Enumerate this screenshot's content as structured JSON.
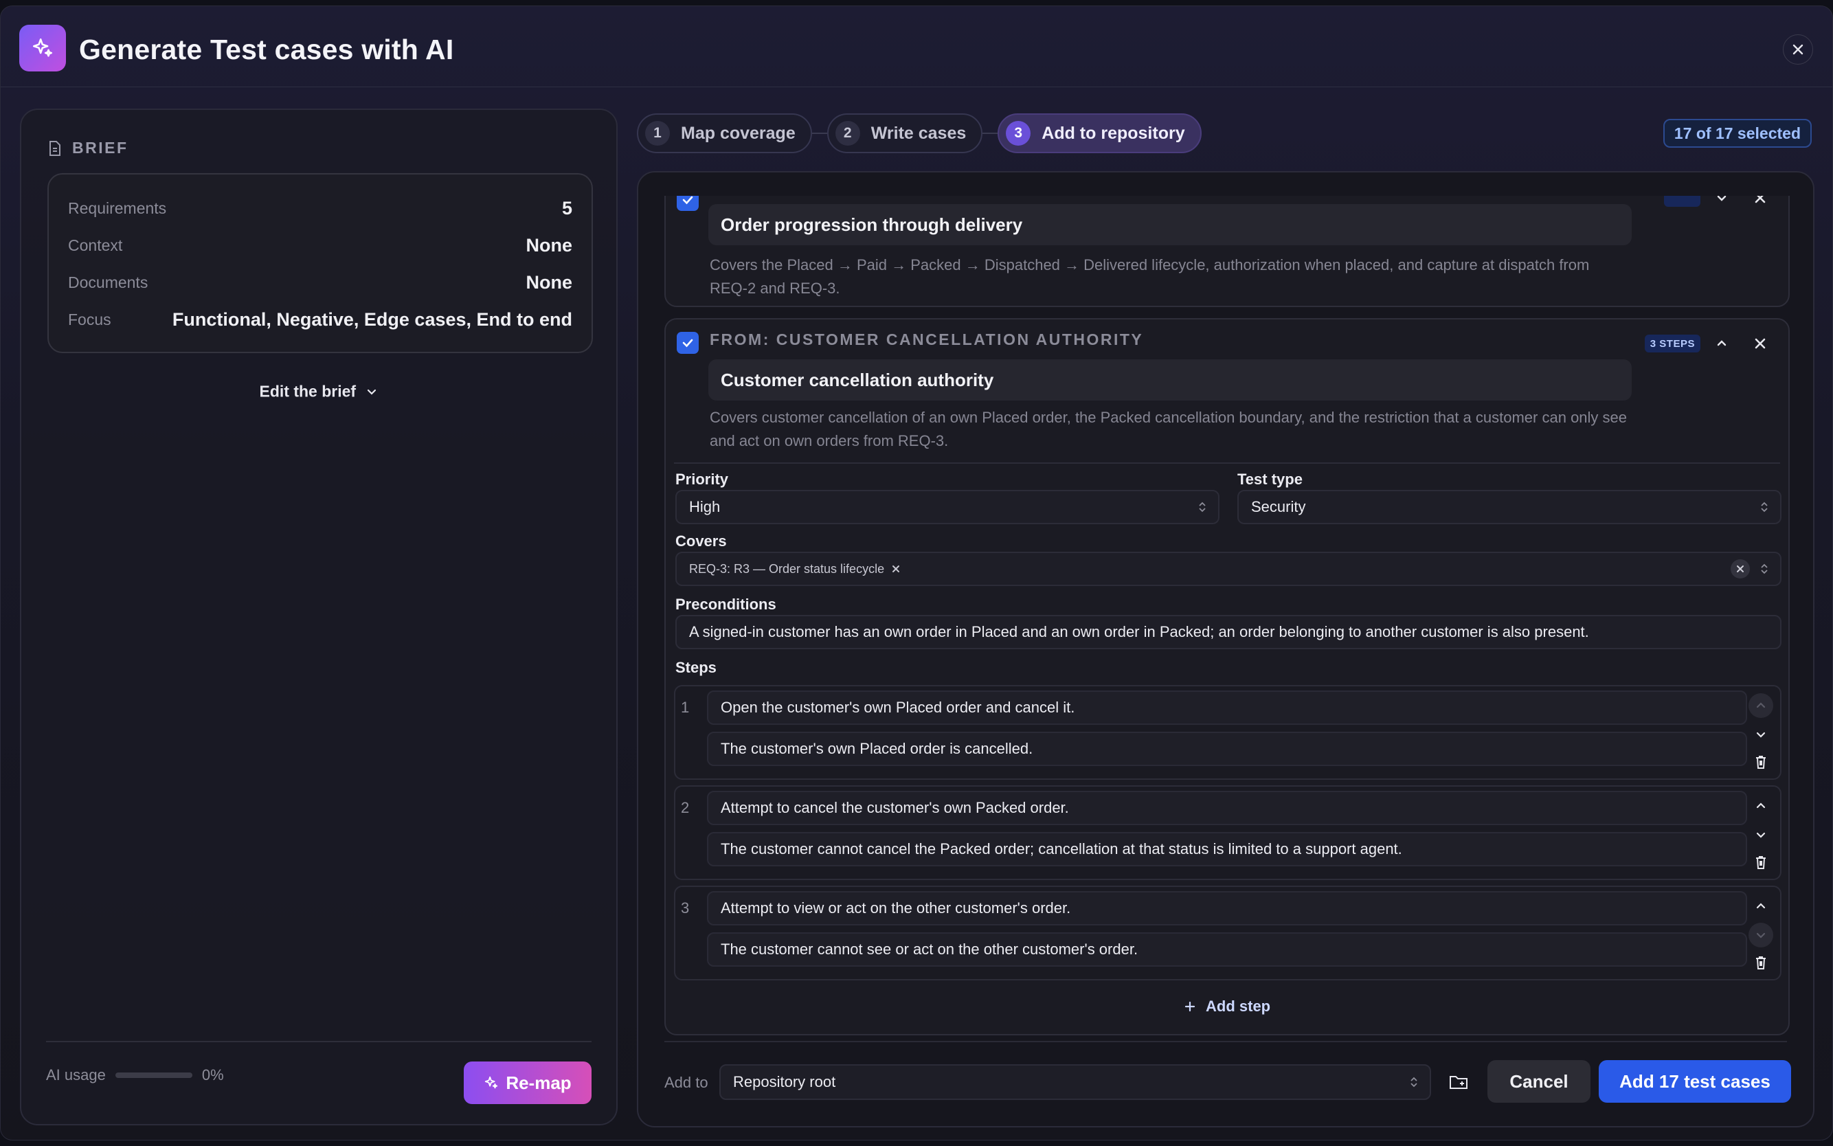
{
  "header": {
    "title": "Generate Test cases with AI"
  },
  "brief": {
    "label": "BRIEF",
    "rows": [
      {
        "key": "Requirements",
        "value": "5"
      },
      {
        "key": "Context",
        "value": "None"
      },
      {
        "key": "Documents",
        "value": "None"
      },
      {
        "key": "Focus",
        "value": "Functional, Negative, Edge cases, End to end"
      }
    ],
    "edit_label": "Edit the brief",
    "ai_usage_label": "AI usage",
    "ai_usage_value": "0%",
    "ai_usage_fraction": 0,
    "remap_label": "Re-map"
  },
  "stepper": {
    "steps": [
      {
        "num": "1",
        "label": "Map coverage"
      },
      {
        "num": "2",
        "label": "Write cases"
      },
      {
        "num": "3",
        "label": "Add to repository"
      }
    ],
    "active_step": 3,
    "selected_text": "17 of 17 selected"
  },
  "cases": [
    {
      "title": "Order progression through delivery",
      "description": "Covers the Placed → Paid → Packed → Dispatched → Delivered lifecycle, authorization when placed, and capture at dispatch from REQ-2 and REQ-3.",
      "checked": true
    },
    {
      "from_label": "FROM: CUSTOMER CANCELLATION AUTHORITY",
      "steps_badge": "3 STEPS",
      "title": "Customer cancellation authority",
      "description": "Covers customer cancellation of an own Placed order, the Packed cancellation boundary, and the restriction that a customer can only see and act on own orders from REQ-3.",
      "checked": true,
      "priority_label": "Priority",
      "priority_value": "High",
      "test_type_label": "Test type",
      "test_type_value": "Security",
      "covers_label": "Covers",
      "covers_chip": "REQ-3: R3 — Order status lifecycle",
      "preconditions_label": "Preconditions",
      "preconditions_value": "A signed-in customer has an own order in Placed and an own order in Packed; an order belonging to another customer is also present.",
      "steps_label": "Steps",
      "steps": [
        {
          "num": "1",
          "action": "Open the customer's own Placed order and cancel it.",
          "expected": "The customer's own Placed order is cancelled."
        },
        {
          "num": "2",
          "action": "Attempt to cancel the customer's own Packed order.",
          "expected": "The customer cannot cancel the Packed order; cancellation at that status is limited to a support agent."
        },
        {
          "num": "3",
          "action": "Attempt to view or act on the other customer's order.",
          "expected": "The customer cannot see or act on the other customer's order."
        }
      ],
      "add_step_label": "Add step"
    }
  ],
  "footer": {
    "add_to_label": "Add to",
    "destination_value": "Repository root",
    "cancel_label": "Cancel",
    "primary_label": "Add 17 test cases"
  },
  "colors": {
    "accent": "#2a5ae8",
    "brand_gradient_start": "#7a5cf5",
    "brand_gradient_end": "#c04fe0"
  },
  "icons": [
    "sparkles-icon",
    "close-icon",
    "document-icon",
    "chevron-down-icon",
    "chevron-up-icon",
    "check-icon",
    "trash-icon",
    "plus-icon",
    "folder-plus-icon",
    "select-arrows-icon"
  ]
}
